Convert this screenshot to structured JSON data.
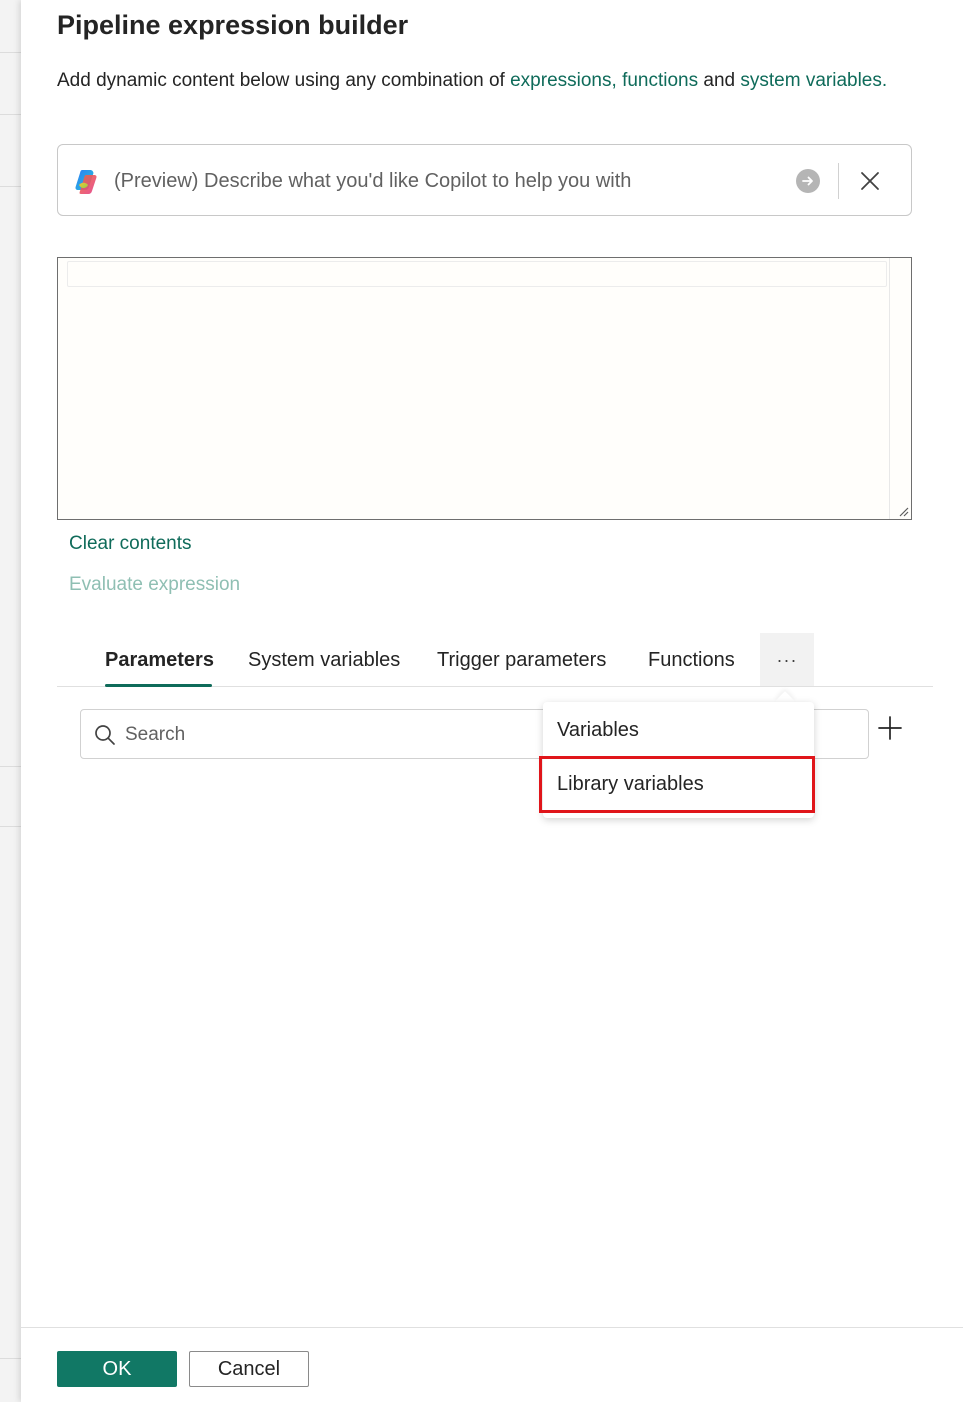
{
  "dialog": {
    "title": "Pipeline expression builder",
    "subtitle_prefix": "Add dynamic content below using any combination of ",
    "link_expressions": "expressions,",
    "link_functions": "functions",
    "subtitle_and": " and ",
    "link_system_variables": "system variables."
  },
  "copilot": {
    "placeholder": "(Preview) Describe what you'd like Copilot to help you with",
    "logo_icon": "copilot-logo-icon",
    "send_icon": "arrow-right-icon",
    "close_icon": "close-icon"
  },
  "editor": {
    "value": ""
  },
  "actions": {
    "clear_contents": "Clear contents",
    "evaluate_expression": "Evaluate expression"
  },
  "tabs": [
    {
      "label": "Parameters",
      "active": true
    },
    {
      "label": "System variables",
      "active": false
    },
    {
      "label": "Trigger parameters",
      "active": false
    },
    {
      "label": "Functions",
      "active": false
    }
  ],
  "more_label": "···",
  "search": {
    "placeholder": "Search",
    "icon": "search-icon"
  },
  "add_icon": "plus-icon",
  "overflow_menu": {
    "items": [
      {
        "label": "Variables",
        "highlighted": false
      },
      {
        "label": "Library variables",
        "highlighted": true
      }
    ]
  },
  "footer": {
    "ok_label": "OK",
    "cancel_label": "Cancel"
  },
  "colors": {
    "accent": "#117865",
    "link": "#0f6b5a",
    "highlight": "#e0151a"
  }
}
